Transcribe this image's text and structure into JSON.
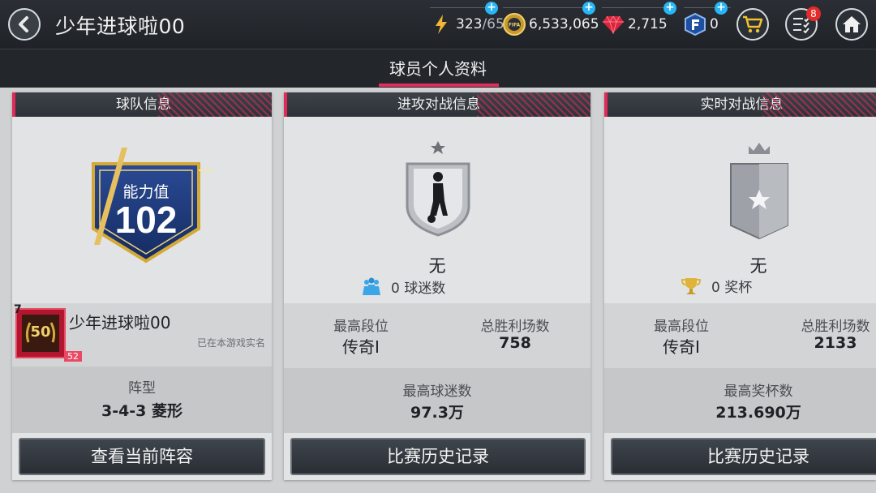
{
  "header": {
    "title": "少年进球啦00",
    "energy": {
      "current": "323",
      "max": "/65"
    },
    "coins": "6,533,065",
    "gems": "2,715",
    "fpoints": "0",
    "notifications_count": "8",
    "coin_icon_text": "FIFA"
  },
  "subheader": {
    "tab_label": "球员个人资料"
  },
  "team_card": {
    "header": "球队信息",
    "rating_label": "能力值",
    "rating_value": "102",
    "player_name": "少年进球啦00",
    "level": "50",
    "level_small": "52",
    "rank_top": "7",
    "verified_text": "已在本游戏实名",
    "formation_label": "阵型",
    "formation_value": "3-4-3 菱形",
    "button": "查看当前阵容"
  },
  "attack_card": {
    "header": "进攻对战信息",
    "rank_name": "无",
    "fans_text": "0 球迷数",
    "highest_rank_label": "最高段位",
    "highest_rank_value": "传奇I",
    "wins_label": "总胜利场数",
    "wins_value": "758",
    "best_label": "最高球迷数",
    "best_value": "97.3万",
    "button": "比赛历史记录"
  },
  "live_card": {
    "header": "实时对战信息",
    "rank_name": "无",
    "trophy_text": "0 奖杯",
    "highest_rank_label": "最高段位",
    "highest_rank_value": "传奇I",
    "wins_label": "总胜利场数",
    "wins_value": "2133",
    "best_label": "最高奖杯数",
    "best_value": "213.690万",
    "button": "比赛历史记录"
  },
  "colors": {
    "accent": "#e22e5a",
    "plus": "#29b6f6",
    "badge": "#e52a2a",
    "navy": "#1d3a7a",
    "gold": "#d4a936"
  }
}
